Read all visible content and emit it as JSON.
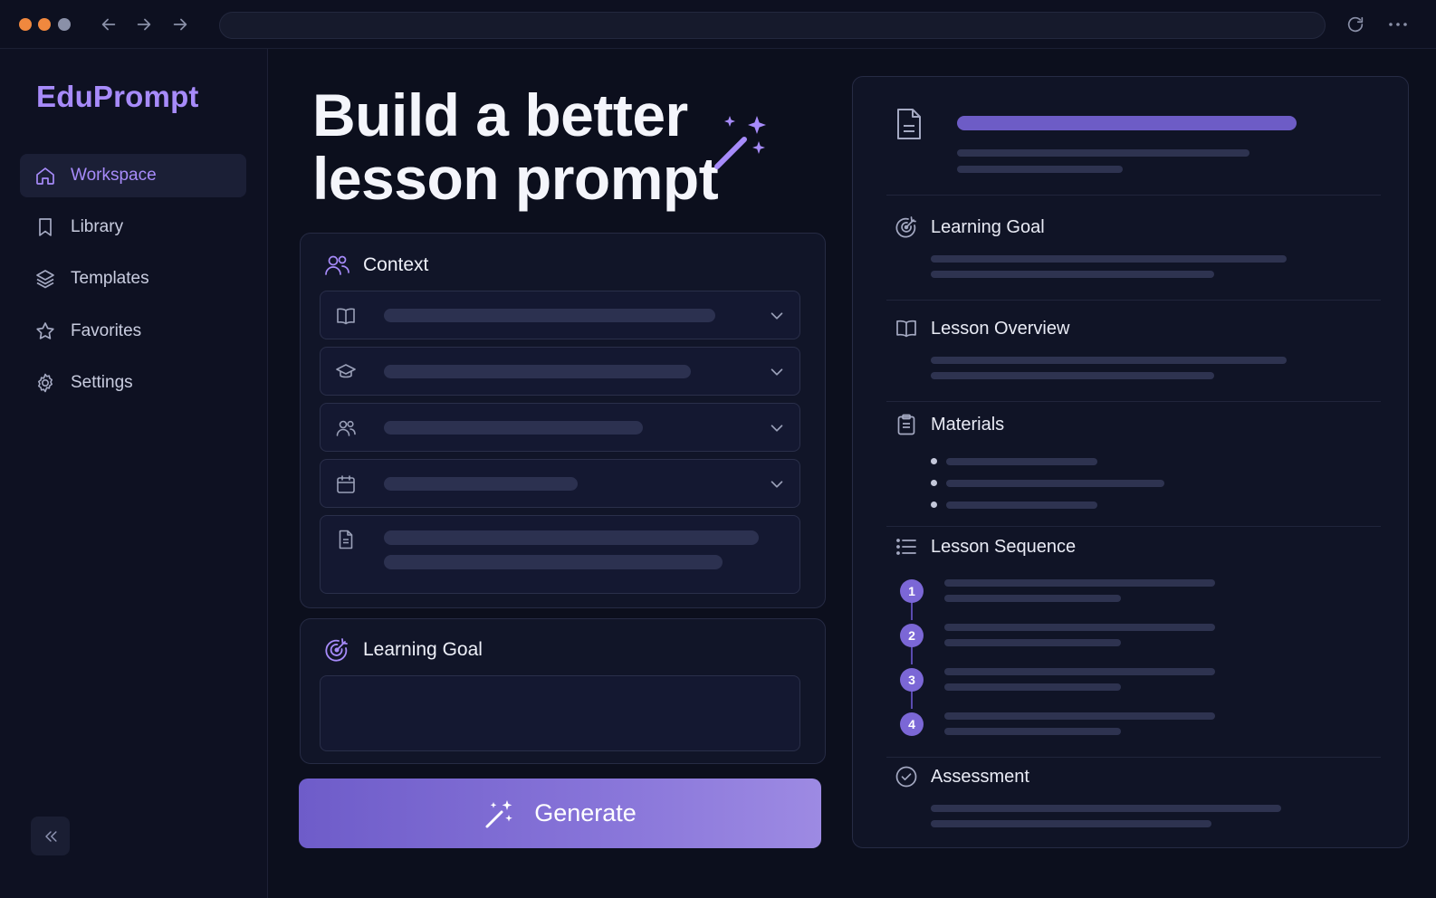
{
  "window": {
    "traffic_lights": [
      "#f0883e",
      "#f0883e",
      "#8a90a8"
    ]
  },
  "sidebar": {
    "brand": "EduPrompt",
    "items": [
      {
        "label": "Workspace",
        "icon": "home-icon",
        "active": true
      },
      {
        "label": "Library",
        "icon": "bookmark-icon",
        "active": false
      },
      {
        "label": "Templates",
        "icon": "layers-icon",
        "active": false
      },
      {
        "label": "Favorites",
        "icon": "star-icon",
        "active": false
      },
      {
        "label": "Settings",
        "icon": "gear-icon",
        "active": false
      }
    ],
    "collapse_icon": "chevrons-left-icon"
  },
  "main": {
    "hero_line1": "Build a better",
    "hero_line2": "lesson prompt",
    "context": {
      "title": "Context",
      "icon": "users-icon",
      "fields": [
        {
          "icon": "book-icon"
        },
        {
          "icon": "graduation-cap-icon"
        },
        {
          "icon": "users-icon"
        },
        {
          "icon": "calendar-icon"
        },
        {
          "icon": "document-icon"
        }
      ]
    },
    "learning_goal": {
      "title": "Learning Goal",
      "icon": "target-icon"
    },
    "generate_label": "Generate"
  },
  "preview": {
    "sections": [
      {
        "title": "Learning Goal",
        "icon": "target-icon"
      },
      {
        "title": "Lesson Overview",
        "icon": "book-icon"
      },
      {
        "title": "Materials",
        "icon": "clipboard-icon"
      },
      {
        "title": "Lesson Sequence",
        "icon": "list-icon"
      },
      {
        "title": "Assessment",
        "icon": "check-circle-icon"
      }
    ],
    "steps": [
      "1",
      "2",
      "3",
      "4"
    ]
  },
  "colors": {
    "accent": "#a78bfa",
    "button_gradient_start": "#6e5cc9",
    "button_gradient_end": "#9d8ae3",
    "background": "#0c0f1d"
  }
}
